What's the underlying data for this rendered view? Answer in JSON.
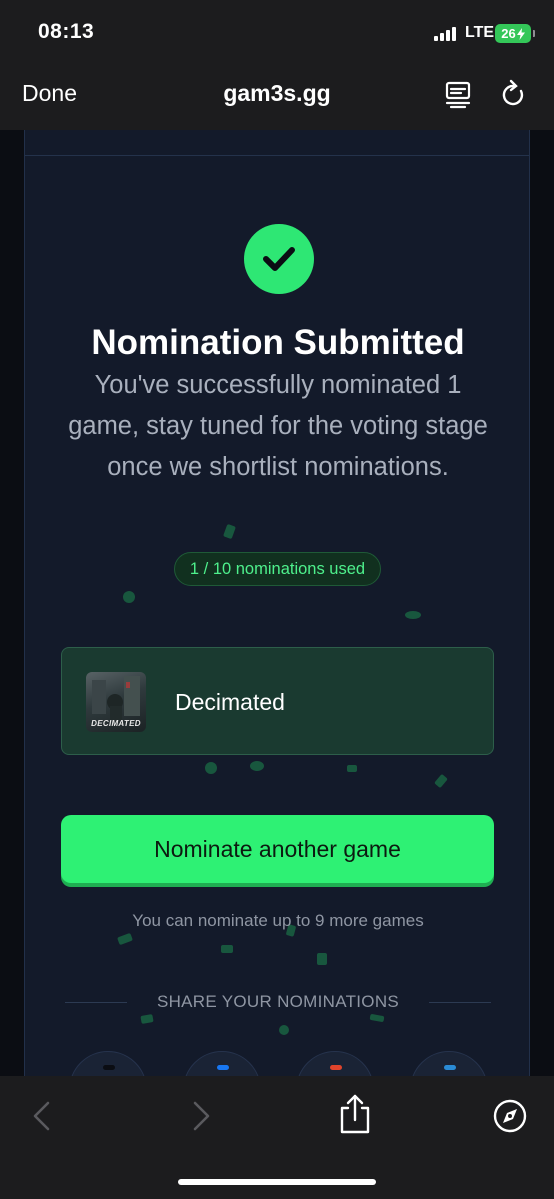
{
  "status_bar": {
    "time": "08:13",
    "network": "LTE",
    "battery": "26"
  },
  "browser": {
    "done_label": "Done",
    "title": "gam3s.gg",
    "icons": [
      "reader-icon",
      "reload-icon"
    ]
  },
  "content": {
    "title": "Nomination Submitted",
    "message": "You've successfully nominated 1 game, stay tuned for the voting stage once we shortlist nominations.",
    "badge": "1 / 10 nominations used",
    "nominated_game": {
      "name": "Decimated",
      "thumbnail_text": "DECIMATED"
    },
    "cta_label": "Nominate another game",
    "hint": "You can nominate up to 9 more games",
    "share_heading": "SHARE YOUR NOMINATIONS"
  },
  "toolbar": {
    "icons": [
      "back-icon",
      "forward-icon",
      "share-icon",
      "compass-icon"
    ]
  },
  "colors": {
    "accent": "#2ef174",
    "card_bg": "#131a2a",
    "page_bg": "#0b0d13",
    "badge_text": "#4ef08c"
  }
}
